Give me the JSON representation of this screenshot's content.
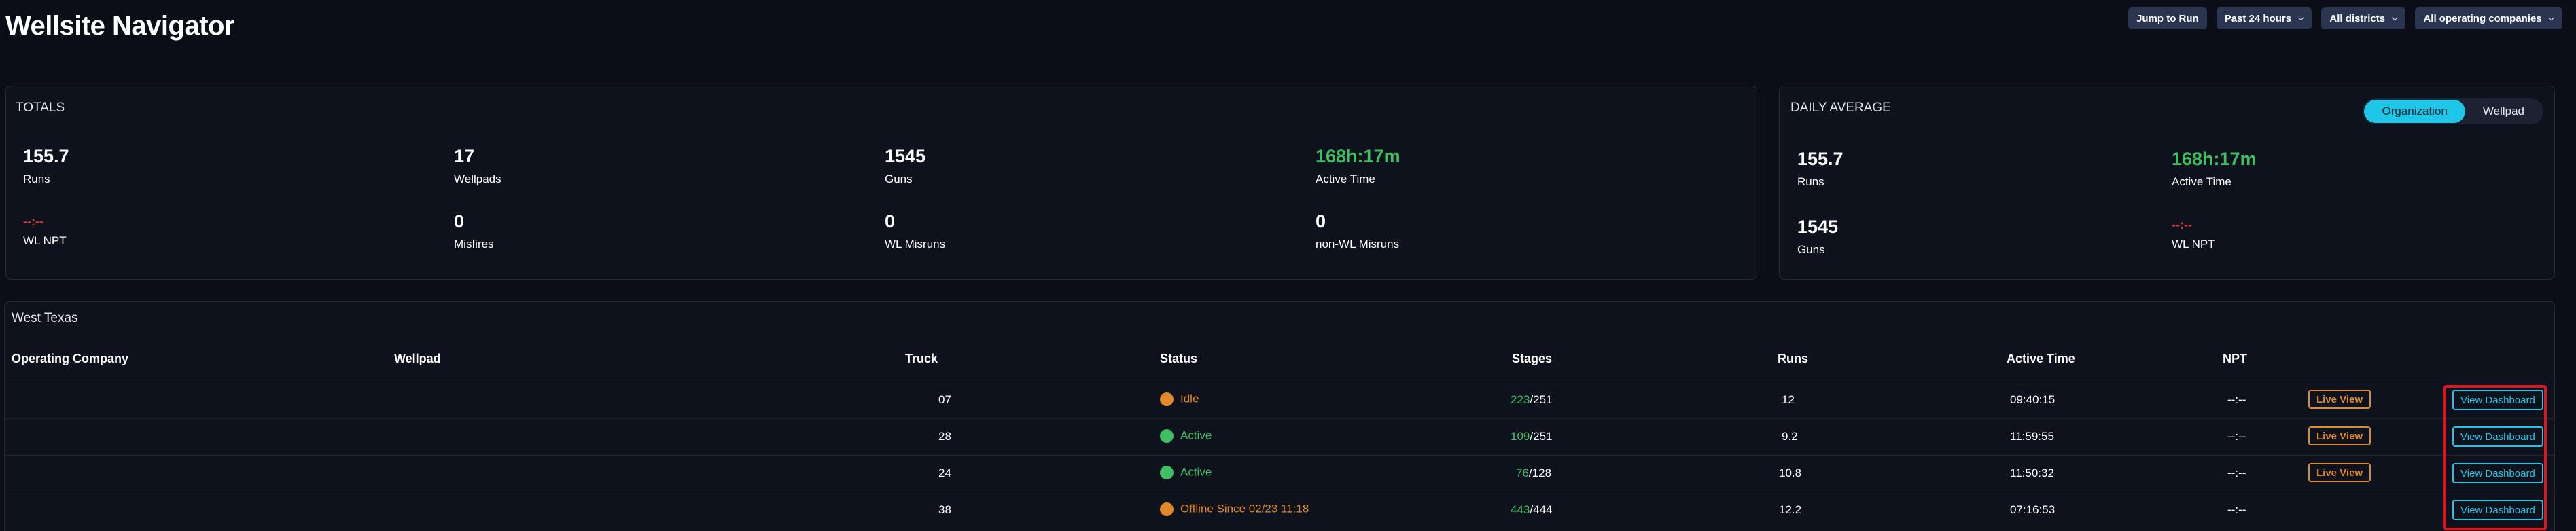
{
  "app": {
    "title": "Wellsite Navigator"
  },
  "header": {
    "jump_to_run": "Jump to Run",
    "time_range": "Past 24 hours",
    "districts": "All districts",
    "companies": "All operating companies"
  },
  "totals": {
    "title": "TOTALS",
    "stats": [
      {
        "value": "155.7",
        "label": "Runs"
      },
      {
        "value": "17",
        "label": "Wellpads"
      },
      {
        "value": "1545",
        "label": "Guns"
      },
      {
        "value": "168h:17m",
        "label": "Active Time"
      },
      {
        "value": "--:--",
        "label": "WL NPT"
      },
      {
        "value": "0",
        "label": "Misfires"
      },
      {
        "value": "0",
        "label": "WL Misruns"
      },
      {
        "value": "0",
        "label": "non-WL Misruns"
      }
    ]
  },
  "daily_average": {
    "title": "DAILY AVERAGE",
    "toggle": {
      "options": [
        "Organization",
        "Wellpad"
      ],
      "selected": "Organization"
    },
    "stats": [
      {
        "value": "155.7",
        "label": "Runs"
      },
      {
        "value": "168h:17m",
        "label": "Active Time"
      },
      {
        "value": "1545",
        "label": "Guns"
      },
      {
        "value": "--:--",
        "label": "WL NPT"
      }
    ]
  },
  "table": {
    "region": "West Texas",
    "columns": [
      "Operating Company",
      "Wellpad",
      "Truck",
      "Status",
      "Stages",
      "Runs",
      "Active Time",
      "NPT"
    ],
    "live_view_label": "Live View",
    "view_dashboard_label": "View Dashboard",
    "rows": [
      {
        "company": "",
        "wellpad": "",
        "truck": "07",
        "status": "Idle",
        "status_color": "#e2892a",
        "stages_done": "223",
        "stages_sep": "/",
        "stages_total": "251",
        "runs": "12",
        "active_time": "09:40:15",
        "npt": "--:--",
        "live": true
      },
      {
        "company": "",
        "wellpad": "",
        "truck": "28",
        "status": "Active",
        "status_color": "#3fbf63",
        "stages_done": "109",
        "stages_sep": "/",
        "stages_total": "251",
        "runs": "9.2",
        "active_time": "11:59:55",
        "npt": "--:--",
        "live": true
      },
      {
        "company": "",
        "wellpad": "",
        "truck": "24",
        "status": "Active",
        "status_color": "#3fbf63",
        "stages_done": "76",
        "stages_sep": "/",
        "stages_total": "128",
        "runs": "10.8",
        "active_time": "11:50:32",
        "npt": "--:--",
        "live": true
      },
      {
        "company": "",
        "wellpad": "",
        "truck": "38",
        "status": "Offline Since 02/23 11:18",
        "status_color": "#e2892a",
        "stages_done": "443",
        "stages_sep": "/",
        "stages_total": "444",
        "runs": "12.2",
        "active_time": "07:16:53",
        "npt": "--:--",
        "live": false
      }
    ]
  },
  "colors": {
    "accent": "#1ec6e8",
    "active": "#3fbf63",
    "warning": "#e2892a",
    "alert": "#e53935",
    "highlight": "#e0141c"
  }
}
